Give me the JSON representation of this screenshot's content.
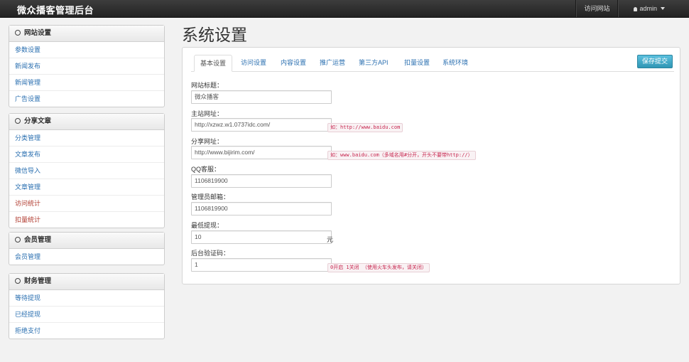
{
  "app": {
    "title": "微众播客管理后台"
  },
  "navbar": {
    "visit_site": "访问网站",
    "user": "admin"
  },
  "sidebar": [
    {
      "title": "网站设置",
      "items": [
        {
          "label": "参数设置",
          "color": "#2a6fb0"
        },
        {
          "label": "新闻发布",
          "color": "#2a6fb0"
        },
        {
          "label": "新闻管理",
          "color": "#2a6fb0"
        },
        {
          "label": "广告设置",
          "color": "#2a6fb0"
        }
      ]
    },
    {
      "title": "分享文章",
      "items": [
        {
          "label": "分类管理",
          "color": "#2a6fb0"
        },
        {
          "label": "文章发布",
          "color": "#2a6fb0"
        },
        {
          "label": "微信导入",
          "color": "#2a6fb0"
        },
        {
          "label": "文章管理",
          "color": "#2a6fb0"
        },
        {
          "label": "访问统计",
          "color": "#b03a2e"
        },
        {
          "label": "扣量统计",
          "color": "#b03a2e"
        }
      ]
    },
    {
      "title": "会员管理",
      "items": [
        {
          "label": "会员管理",
          "color": "#2a6fb0"
        }
      ]
    },
    {
      "title": "财务管理",
      "items": [
        {
          "label": "等待提现",
          "color": "#2a6fb0"
        },
        {
          "label": "已经提现",
          "color": "#2a6fb0"
        },
        {
          "label": "拒绝支付",
          "color": "#2a6fb0"
        }
      ]
    }
  ],
  "main": {
    "page_title": "系统设置",
    "save_button": "保存提交",
    "tabs": [
      "基本设置",
      "访问设置",
      "内容设置",
      "推广运营",
      "第三方API",
      "扣量设置",
      "系统环境"
    ],
    "fields": [
      {
        "label": "网站标题：",
        "value": "微众播客",
        "hint": "",
        "unit": ""
      },
      {
        "label": "主站网址：",
        "value": "http://xzwz.w1.0737idc.com/",
        "hint": "如：http://www.baidu.com",
        "unit": ""
      },
      {
        "label": "分享网址：",
        "value": "http://www.bijirim.com/",
        "hint": "如：www.baidu.com（多域名用#分开，开头不要带http://）",
        "unit": ""
      },
      {
        "label": "QQ客服：",
        "value": "1106819900",
        "hint": "",
        "unit": ""
      },
      {
        "label": "管理员邮箱：",
        "value": "1106819900",
        "hint": "",
        "unit": ""
      },
      {
        "label": "最低提现：",
        "value": "10",
        "hint": "",
        "unit": "元"
      },
      {
        "label": "后台验证码：",
        "value": "1",
        "hint": "0开启 1关闭 （使用火车头发布，请关闭）",
        "unit": ""
      }
    ]
  }
}
